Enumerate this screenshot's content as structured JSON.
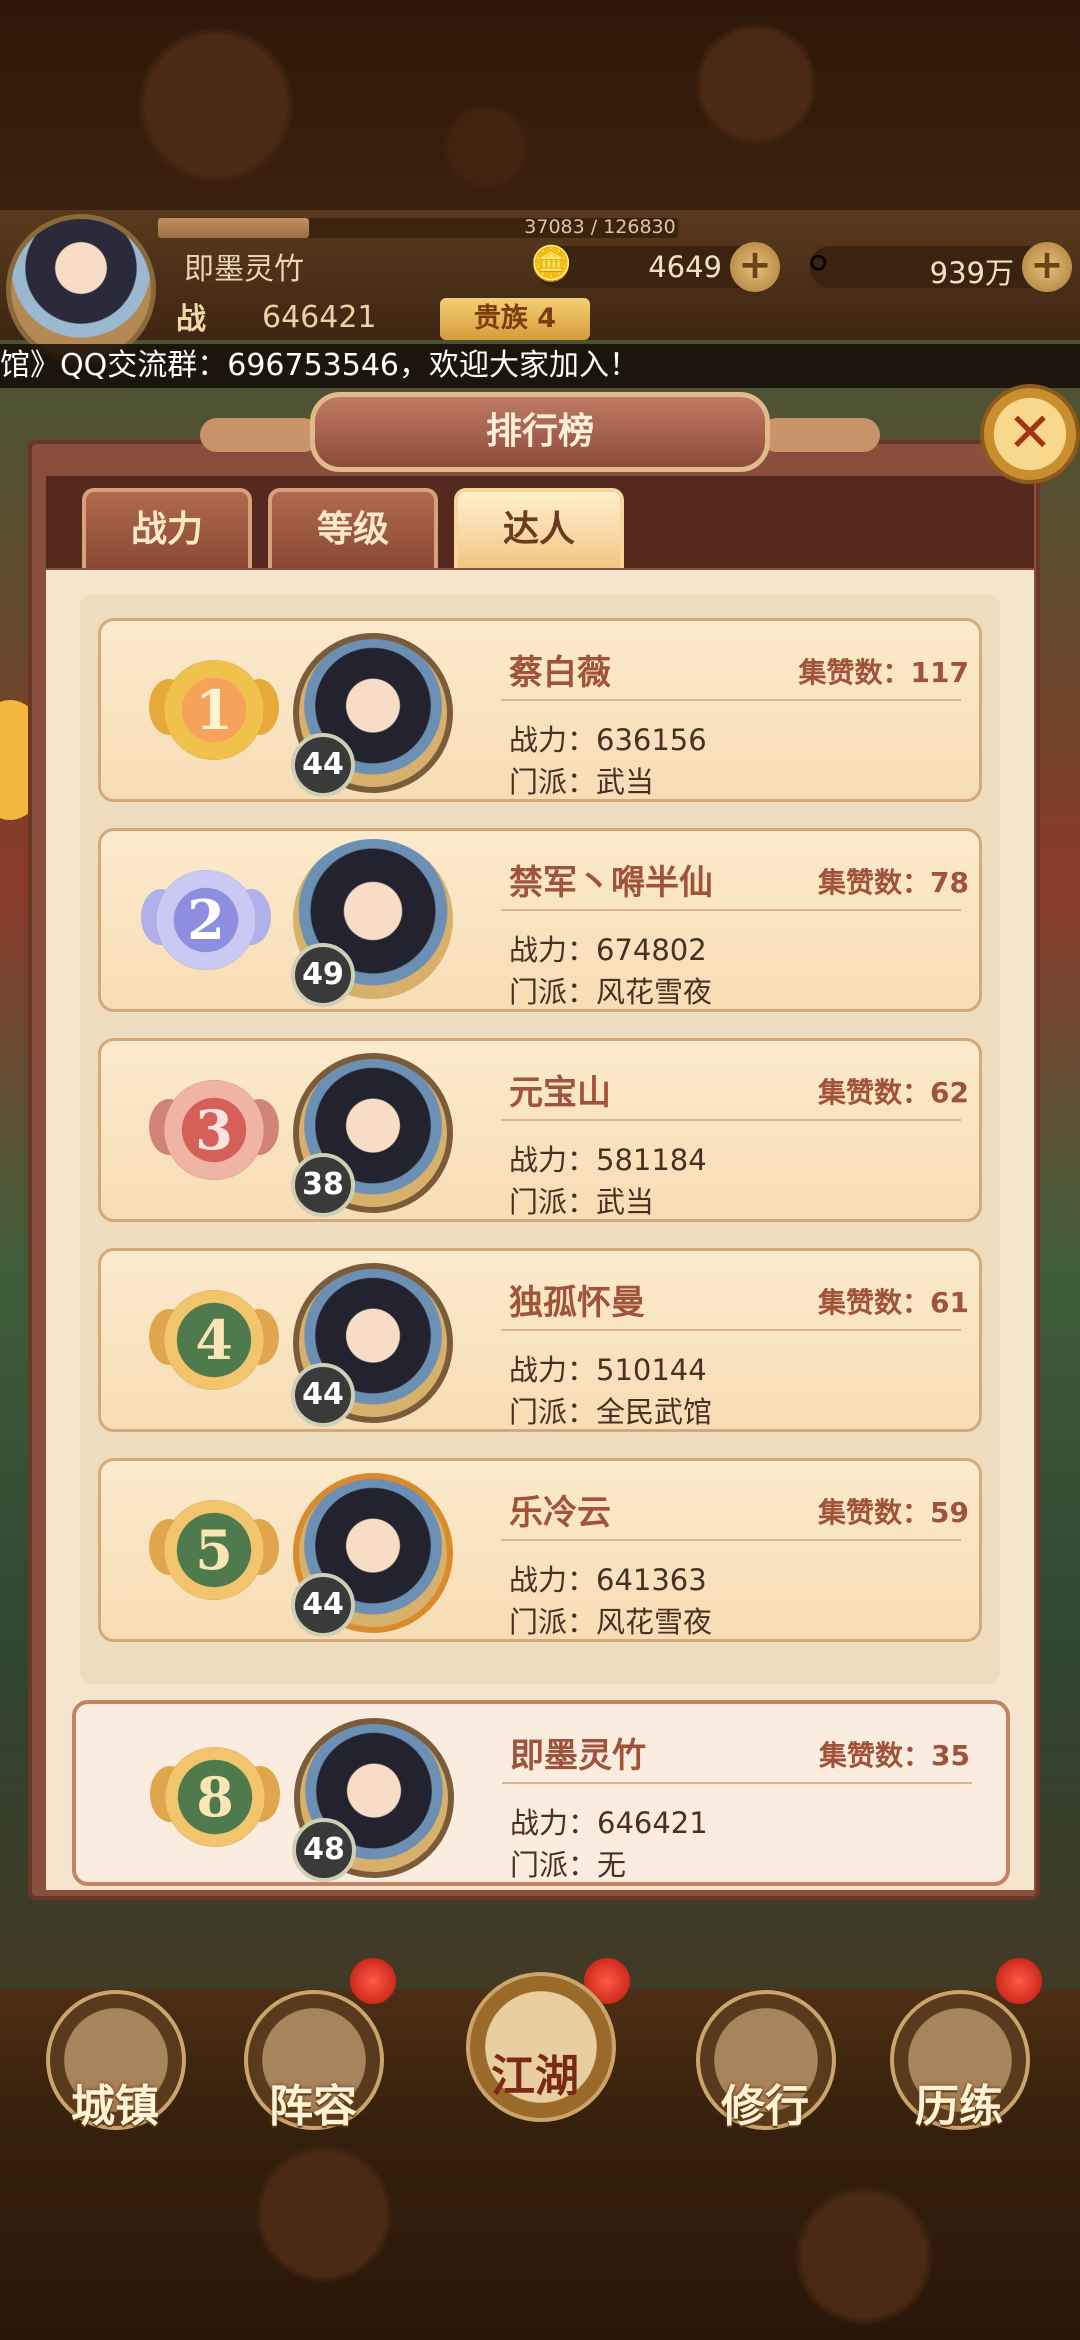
{
  "header": {
    "player_name": "即墨灵竹",
    "exp_text": "37083 / 126830",
    "exp_progress": 0.29,
    "gold": "4649",
    "silver": "939万",
    "power_label": "战",
    "power": "646421",
    "noble": "贵族 4"
  },
  "ticker": "馆》QQ交流群：696753546，欢迎大家加入！",
  "panel": {
    "title": "排行榜",
    "close_label": "✕",
    "tabs": [
      {
        "label": "战力",
        "active": false
      },
      {
        "label": "等级",
        "active": false
      },
      {
        "label": "达人",
        "active": true
      }
    ]
  },
  "rankings": [
    {
      "rank": "1",
      "name": "蔡白薇",
      "likes": "集赞数：117",
      "power": "战力：636156",
      "sect": "门派：武当",
      "level": "44"
    },
    {
      "rank": "2",
      "name": "禁军丶嘚半仙",
      "likes": "集赞数：78",
      "power": "战力：674802",
      "sect": "门派：风花雪夜",
      "level": "49"
    },
    {
      "rank": "3",
      "name": "元宝山",
      "likes": "集赞数：62",
      "power": "战力：581184",
      "sect": "门派：武当",
      "level": "38"
    },
    {
      "rank": "4",
      "name": "独孤怀曼",
      "likes": "集赞数：61",
      "power": "战力：510144",
      "sect": "门派：全民武馆",
      "level": "44"
    },
    {
      "rank": "5",
      "name": "乐冷云",
      "likes": "集赞数：59",
      "power": "战力：641363",
      "sect": "门派：风花雪夜",
      "level": "44"
    }
  ],
  "my_rank": {
    "rank": "8",
    "name": "即墨灵竹",
    "likes": "集赞数：35",
    "power": "战力：646421",
    "sect": "门派：无",
    "level": "48"
  },
  "nav": [
    {
      "label": "城镇"
    },
    {
      "label": "阵容"
    },
    {
      "label": "江湖"
    },
    {
      "label": "修行"
    },
    {
      "label": "历练"
    }
  ]
}
